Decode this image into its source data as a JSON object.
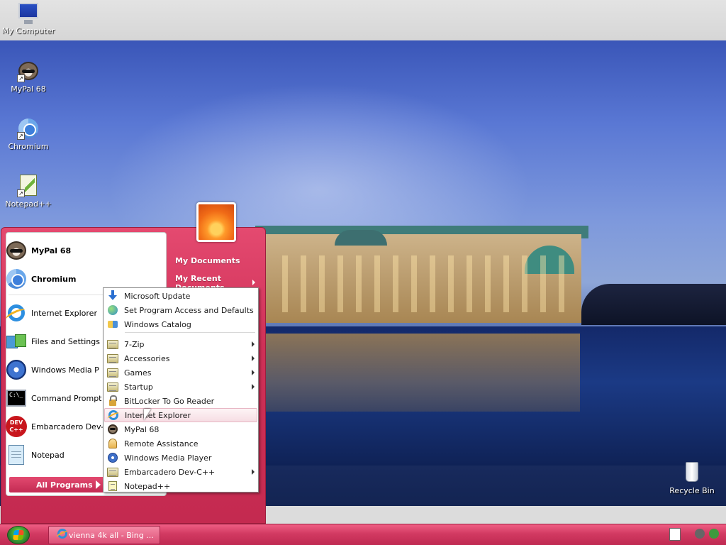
{
  "desktop": {
    "icons": [
      {
        "label": "My Computer",
        "icon": "computer-icon"
      },
      {
        "label": "MyPal 68",
        "icon": "mypal-icon"
      },
      {
        "label": "Chromium",
        "icon": "chromium-icon"
      },
      {
        "label": "Notepad++",
        "icon": "notepadpp-icon"
      },
      {
        "label": "Recycle Bin",
        "icon": "recycle-bin-icon"
      }
    ]
  },
  "start_menu": {
    "pinned": [
      {
        "label": "MyPal 68",
        "icon": "mypal-icon",
        "bold": true
      },
      {
        "label": "Chromium",
        "icon": "chromium-icon",
        "bold": true
      },
      {
        "label": "Internet Explorer",
        "icon": "internet-explorer-icon"
      },
      {
        "label": "Files and Settings",
        "icon": "files-transfer-icon"
      },
      {
        "label": "Windows Media P",
        "icon": "media-player-icon"
      },
      {
        "label": "Command Prompt",
        "icon": "command-prompt-icon"
      },
      {
        "label": "Embarcadero Dev-",
        "icon": "devcpp-icon"
      },
      {
        "label": "Notepad",
        "icon": "notepad-icon"
      }
    ],
    "all_programs": "All Programs",
    "right": {
      "my_documents": "My Documents",
      "my_recent_documents": "My Recent Documents"
    }
  },
  "programs_menu": {
    "items": [
      {
        "label": "Microsoft Update",
        "icon": "windows-update-icon",
        "submenu": false
      },
      {
        "label": "Set Program Access and Defaults",
        "icon": "program-defaults-icon",
        "submenu": false
      },
      {
        "label": "Windows Catalog",
        "icon": "windows-catalog-icon",
        "submenu": false
      },
      {
        "label": "7-Zip",
        "icon": "folder-icon",
        "submenu": true
      },
      {
        "label": "Accessories",
        "icon": "folder-icon",
        "submenu": true
      },
      {
        "label": "Games",
        "icon": "folder-icon",
        "submenu": true
      },
      {
        "label": "Startup",
        "icon": "folder-icon",
        "submenu": true
      },
      {
        "label": "BitLocker To Go Reader",
        "icon": "bitlocker-icon",
        "submenu": false
      },
      {
        "label": "Internet Explorer",
        "icon": "internet-explorer-icon",
        "submenu": false,
        "highlighted": true
      },
      {
        "label": "MyPal 68",
        "icon": "mypal-icon",
        "submenu": false
      },
      {
        "label": "Remote Assistance",
        "icon": "remote-assistance-icon",
        "submenu": false
      },
      {
        "label": "Windows Media Player",
        "icon": "media-player-icon",
        "submenu": false
      },
      {
        "label": "Embarcadero Dev-C++",
        "icon": "folder-icon",
        "submenu": true
      },
      {
        "label": "Notepad++",
        "icon": "notepadpp-icon",
        "submenu": false
      }
    ]
  },
  "taskbar": {
    "task_label": "vienna 4k all - Bing ...",
    "colors": {
      "accent": "#d23a62",
      "menu_pink": "#cf3057"
    }
  }
}
